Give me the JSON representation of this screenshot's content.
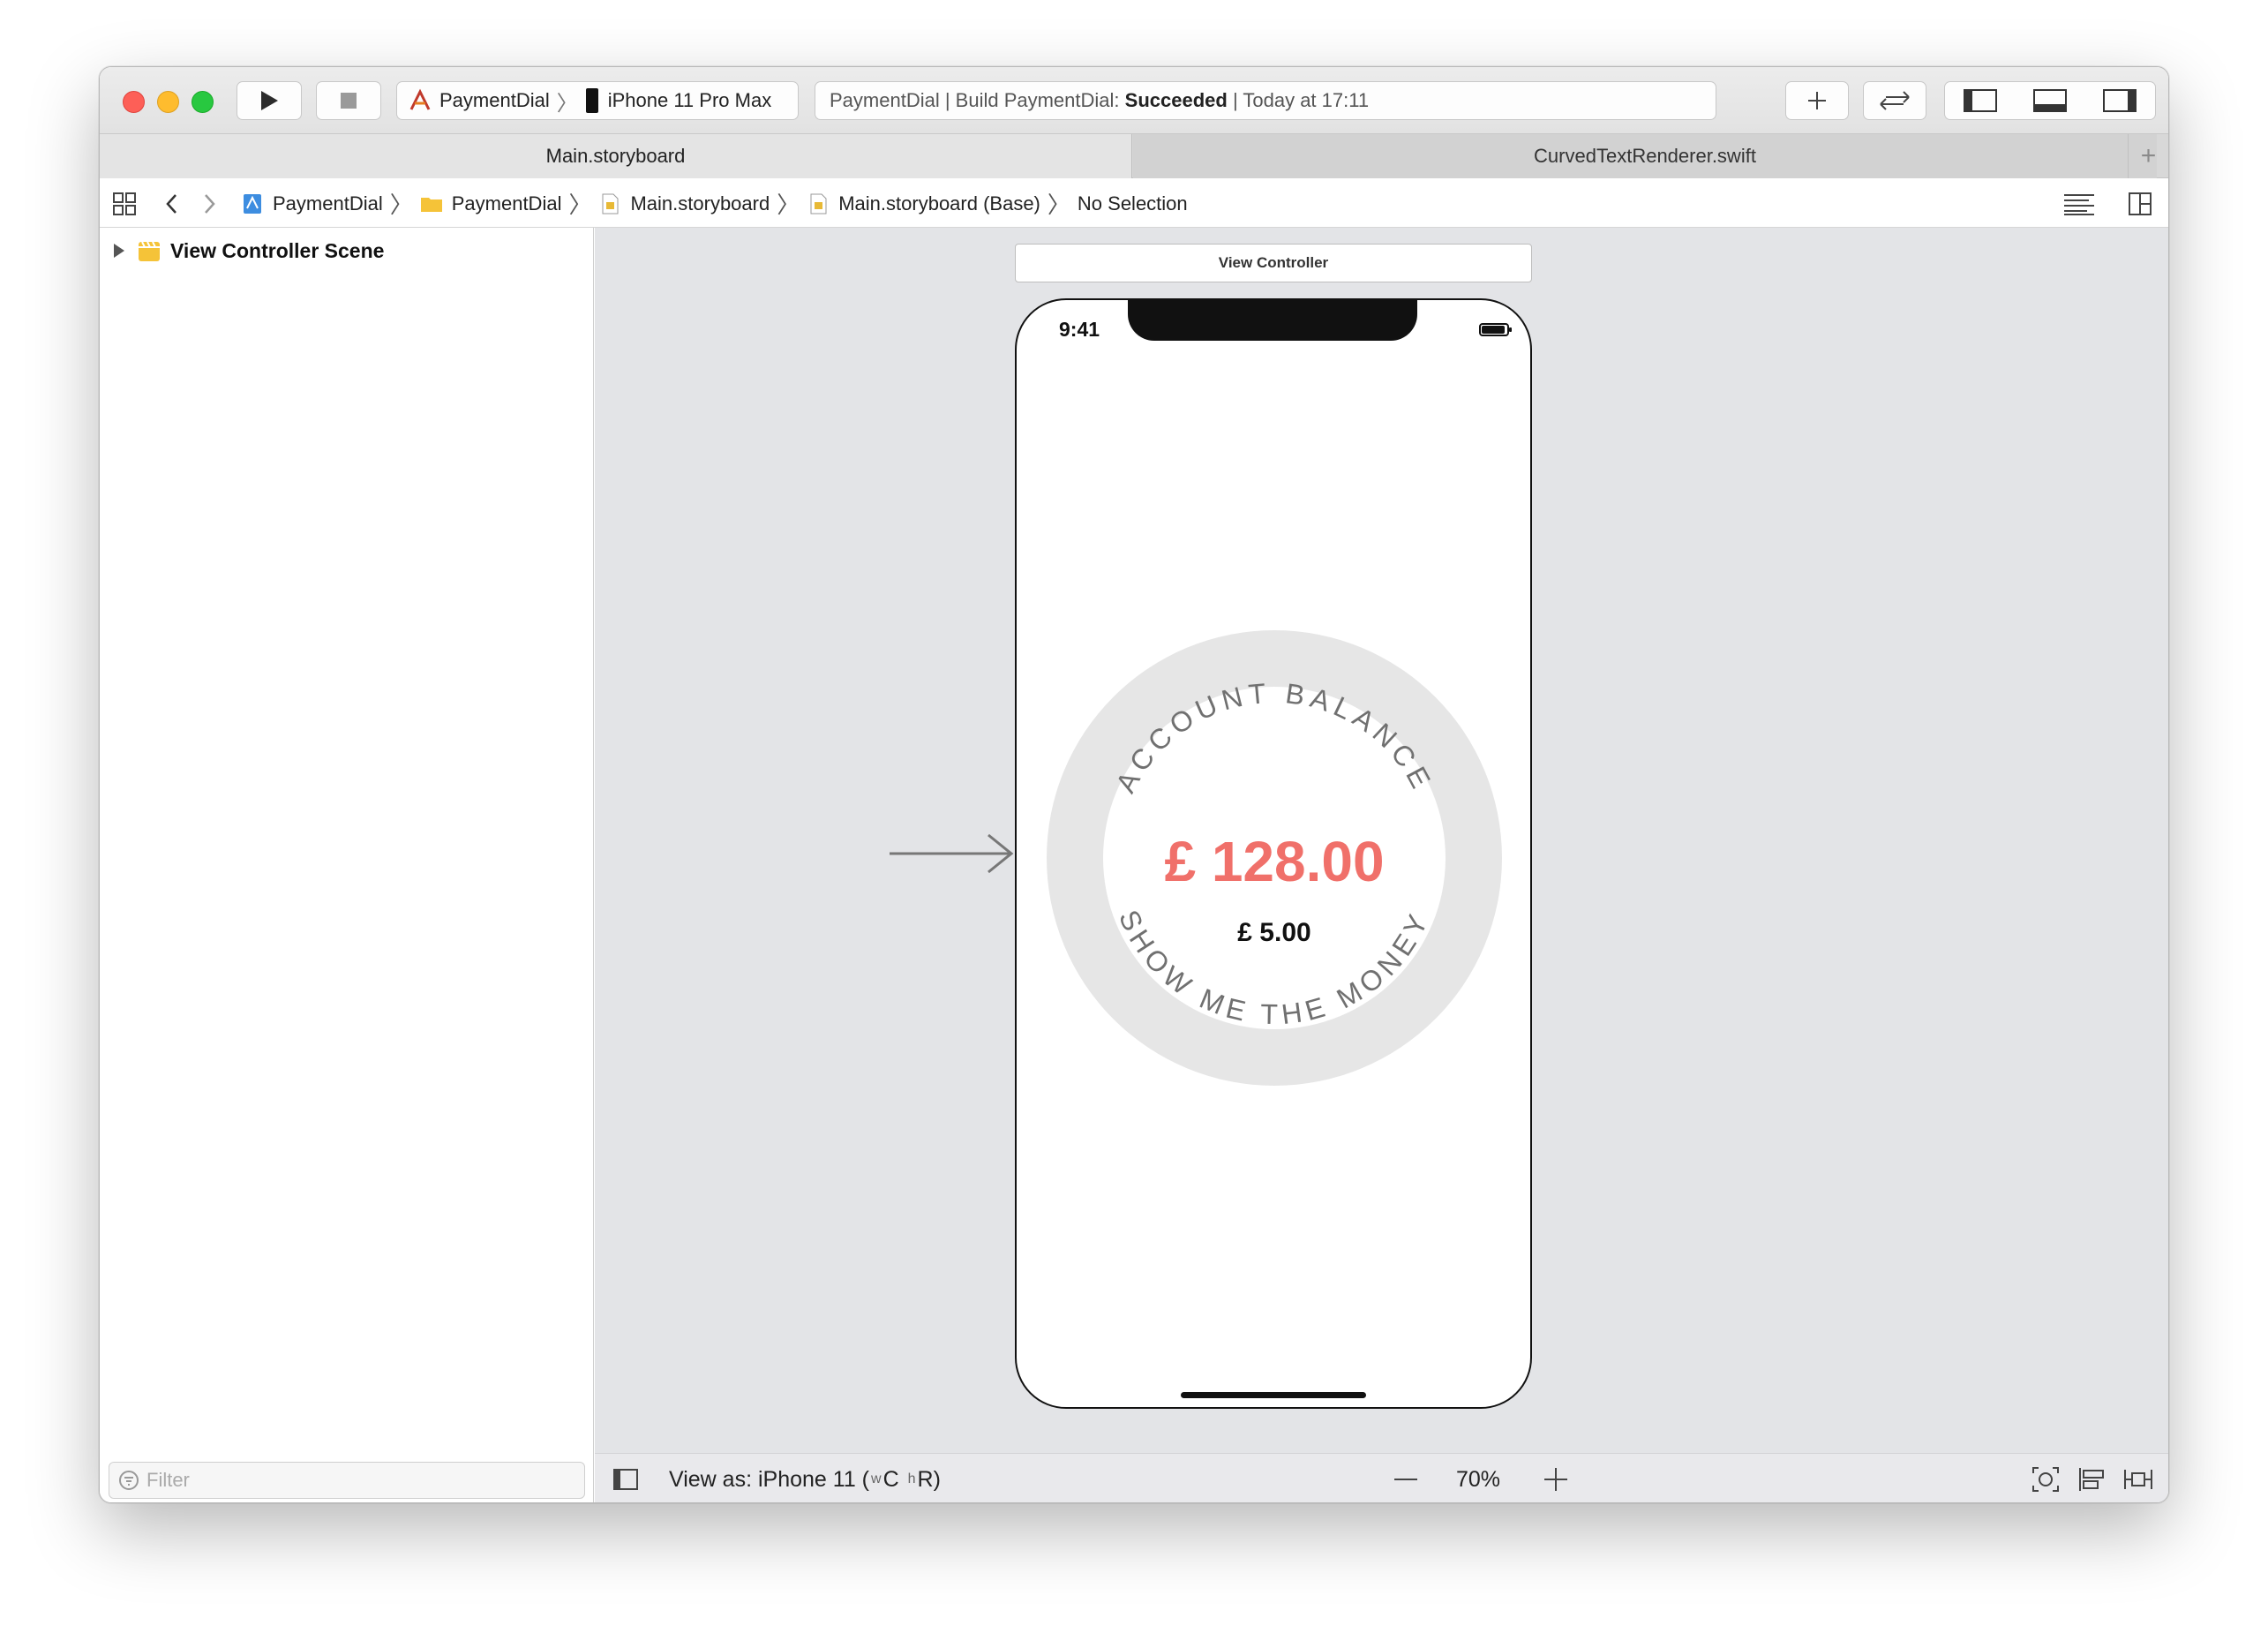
{
  "toolbar": {
    "run_button": "run",
    "stop_button": "stop",
    "scheme": "PaymentDial",
    "device": "iPhone 11 Pro Max",
    "status_prefix": "PaymentDial | Build PaymentDial:",
    "status_result": "Succeeded",
    "status_time": "| Today at 17:11"
  },
  "tabs": [
    {
      "label": "Main.storyboard",
      "active": true
    },
    {
      "label": "CurvedTextRenderer.swift",
      "active": false
    }
  ],
  "breadcrumb": [
    "PaymentDial",
    "PaymentDial",
    "Main.storyboard",
    "Main.storyboard (Base)",
    "No Selection"
  ],
  "navigator": {
    "scene_label": "View Controller Scene",
    "filter_placeholder": "Filter"
  },
  "canvas": {
    "vc_label": "View Controller",
    "status_time": "9:41",
    "dial": {
      "top_text": "ACCOUNT BALANCE",
      "bottom_text": "SHOW ME THE MONEY",
      "balance": "£ 128.00",
      "amount": "£ 5.00",
      "accent_color": "#f0706a",
      "ring_color": "#e6e6e6"
    }
  },
  "bottombar": {
    "view_as_prefix": "View as: iPhone 11 (",
    "size_w": "w",
    "size_c": "C",
    "size_h": "h",
    "size_r": "R)",
    "zoom": "70%"
  }
}
